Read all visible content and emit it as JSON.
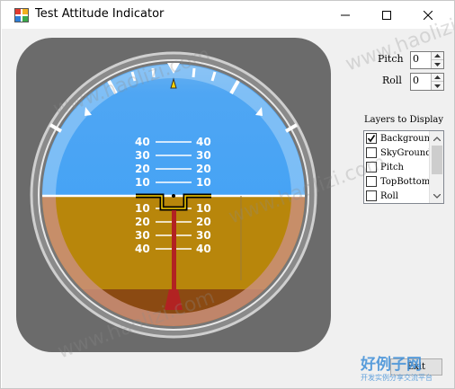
{
  "window": {
    "title": "Test Attitude Indicator",
    "minimize_icon": "minimize-icon",
    "maximize_icon": "maximize-icon",
    "close_icon": "close-icon"
  },
  "instrument": {
    "pitch_scale_up": [
      "10",
      "20",
      "30",
      "40"
    ],
    "pitch_scale_down": [
      "10",
      "20",
      "30",
      "40"
    ],
    "colors": {
      "sky": "#4aa7f5",
      "sky_top": "#78b8ef",
      "ground": "#b8860b",
      "ground_dark": "#8b4a12",
      "bezel": "#6b6b6b",
      "pointer": "#b22222",
      "roll_pointer": "#ffd400"
    }
  },
  "controls": {
    "pitch_label": "Pitch",
    "pitch_value": "0",
    "roll_label": "Roll",
    "roll_value": "0",
    "layers_label": "Layers to Display",
    "layers": [
      {
        "label": "Background",
        "checked": true
      },
      {
        "label": "SkyGround",
        "checked": false
      },
      {
        "label": "Pitch",
        "checked": false
      },
      {
        "label": "TopBottom",
        "checked": false
      },
      {
        "label": "Roll",
        "checked": false
      }
    ],
    "exit_label": "Exit"
  },
  "watermark": {
    "text": "www.haolizi.com",
    "logo_text": "好例子网",
    "logo_subtext": "开发实例分享交流平台"
  }
}
